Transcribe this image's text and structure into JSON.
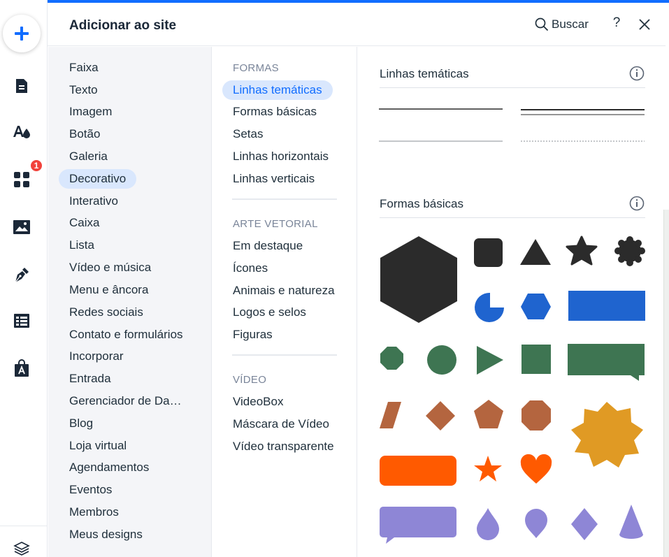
{
  "rail": {
    "add_icon": "plus-icon",
    "items": [
      {
        "icon": "pages-icon"
      },
      {
        "icon": "design-icon"
      },
      {
        "icon": "apps-icon",
        "badge": "1"
      },
      {
        "icon": "media-icon"
      },
      {
        "icon": "pen-icon"
      },
      {
        "icon": "table-icon"
      },
      {
        "icon": "store-bag-icon"
      },
      {
        "icon": "layers-icon"
      }
    ]
  },
  "header": {
    "title": "Adicionar ao site",
    "search_label": "Buscar",
    "help_label": "?"
  },
  "categories": [
    "Faixa",
    "Texto",
    "Imagem",
    "Botão",
    "Galeria",
    "Decorativo",
    "Interativo",
    "Caixa",
    "Lista",
    "Vídeo e música",
    "Menu e âncora",
    "Redes sociais",
    "Contato e formulários",
    "Incorporar",
    "Entrada",
    "Gerenciador de Da…",
    "Blog",
    "Loja virtual",
    "Agendamentos",
    "Eventos",
    "Membros",
    "Meus designs"
  ],
  "active_category": "Decorativo",
  "subcategories": {
    "sections": [
      {
        "title": "FORMAS",
        "items": [
          "Linhas temáticas",
          "Formas básicas",
          "Setas",
          "Linhas horizontais",
          "Linhas verticais"
        ]
      },
      {
        "title": "ARTE VETORIAL",
        "items": [
          "Em destaque",
          "Ícones",
          "Animais e natureza",
          "Logos e selos",
          "Figuras"
        ]
      },
      {
        "title": "VÍDEO",
        "items": [
          "VideoBox",
          "Máscara de Vídeo",
          "Vídeo transparente"
        ]
      }
    ],
    "active": "Linhas temáticas"
  },
  "content": {
    "groups": [
      {
        "title": "Linhas temáticas"
      },
      {
        "title": "Formas básicas"
      }
    ],
    "colors": {
      "dark": "#2b2b2b",
      "blue": "#1f64cf",
      "green": "#3e7552",
      "brown": "#b4653f",
      "orange": "#ff5a00",
      "gold": "#e09a24",
      "lavender": "#8e86d6",
      "accent": "#116dff"
    }
  }
}
